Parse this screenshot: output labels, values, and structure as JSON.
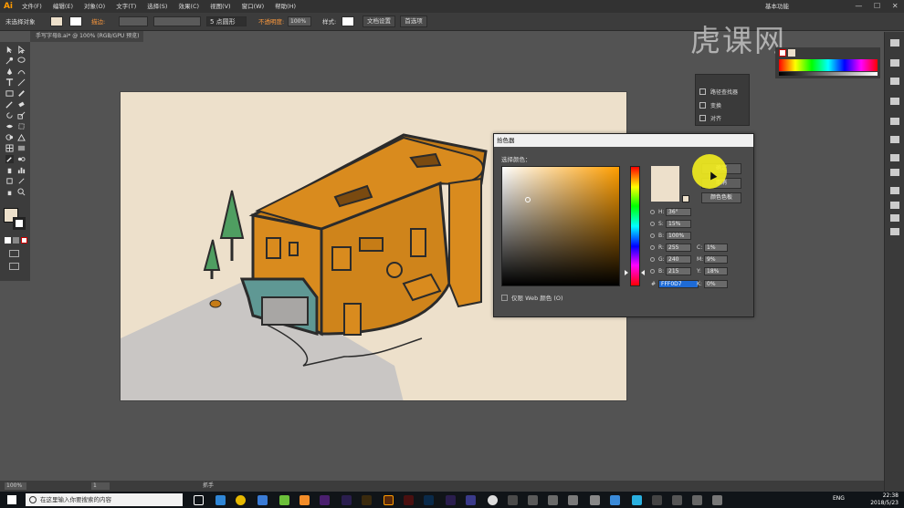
{
  "app": {
    "logo": "Ai",
    "workspace": "基本功能",
    "window_controls": [
      "—",
      "☐",
      "✕"
    ]
  },
  "menu": [
    "文件(F)",
    "编辑(E)",
    "对象(O)",
    "文字(T)",
    "选择(S)",
    "效果(C)",
    "视图(V)",
    "窗口(W)",
    "帮助(H)"
  ],
  "controlbar": {
    "selection": "未选择对象",
    "stroke_label": "描边:",
    "brush": "5 点圆形",
    "opacity_label": "不透明度:",
    "opacity_value": "100%",
    "style_label": "样式:",
    "doc_setup": "文档设置",
    "preferences": "首选项"
  },
  "document": {
    "tab_title": "手写字母B.ai* @ 100% (RGB/GPU 预览)"
  },
  "panels": {
    "mini": [
      "路径查找器",
      "变换",
      "对齐"
    ]
  },
  "picker": {
    "title": "拾色器",
    "prompt": "选择颜色：",
    "ok": "确定",
    "cancel": "取消",
    "swatches": "颜色色板",
    "hsb": [
      {
        "k": "H:",
        "v": "36°"
      },
      {
        "k": "S:",
        "v": "15%"
      },
      {
        "k": "B:",
        "v": "100%"
      }
    ],
    "rgb": [
      {
        "k": "R:",
        "v": "255"
      },
      {
        "k": "G:",
        "v": "240"
      },
      {
        "k": "B:",
        "v": "215"
      }
    ],
    "cmyk": [
      {
        "k": "C:",
        "v": "1%"
      },
      {
        "k": "M:",
        "v": "9%"
      },
      {
        "k": "Y:",
        "v": "18%"
      },
      {
        "k": "K:",
        "v": "0%"
      }
    ],
    "hex_label": "#",
    "hex": "FFF0D7",
    "web_only": "仅限 Web 颜色 (O)",
    "new_color": "#ede0cb"
  },
  "statusbar": {
    "zoom": "100%",
    "page": "1",
    "tool": "抓手"
  },
  "taskbar": {
    "search_placeholder": "在这里输入你要搜索的内容",
    "lang": "ENG",
    "time": "22:38",
    "date": "2018/5/23"
  },
  "watermark": "虎课网",
  "colors": {
    "accent": "#ff9a00",
    "artboard": "#ede0cb",
    "building": "#d98b1e",
    "outline": "#3a2a1a"
  }
}
